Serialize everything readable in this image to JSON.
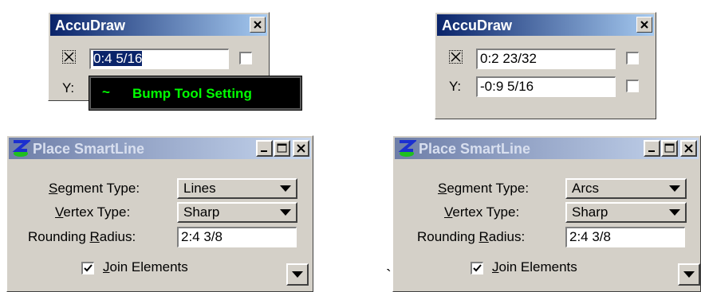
{
  "left": {
    "accudraw": {
      "title": "AccuDraw",
      "x_label": "X:",
      "x_value": "0:4  5/16",
      "y_label": "Y:",
      "tooltip_symbol": "~",
      "tooltip_text": "Bump Tool Setting"
    },
    "smartline": {
      "title": "Place SmartLine",
      "segment_label_u": "S",
      "segment_label_rest": "egment Type:",
      "segment_value": "Lines",
      "vertex_label_u": "V",
      "vertex_label_rest": "ertex Type:",
      "vertex_value": "Sharp",
      "rounding_label_a": "Rounding ",
      "rounding_label_u": "R",
      "rounding_label_b": "adius:",
      "rounding_value": "2:4  3/8",
      "join_label_u": "J",
      "join_label_rest": "oin Elements"
    }
  },
  "right": {
    "accudraw": {
      "title": "AccuDraw",
      "x_label": "X:",
      "x_value": "0:2  23/32",
      "y_label": "Y:",
      "y_value": "-0:9  5/16"
    },
    "smartline": {
      "title": "Place SmartLine",
      "segment_label_u": "S",
      "segment_label_rest": "egment Type:",
      "segment_value": "Arcs",
      "vertex_label_u": "V",
      "vertex_label_rest": "ertex Type:",
      "vertex_value": "Sharp",
      "rounding_label_a": "Rounding ",
      "rounding_label_u": "R",
      "rounding_label_b": "adius:",
      "rounding_value": "2:4  3/8",
      "join_label_u": "J",
      "join_label_rest": "oin Elements"
    }
  },
  "stray_mark": "`",
  "colors": {
    "dialog_bg": "#d4d0c8",
    "active_title_start": "#0a246a",
    "active_title_end": "#a6caf0",
    "tooltip_bg": "#000000",
    "tooltip_text": "#00ff00"
  },
  "icons": [
    "close-icon",
    "minimize-icon",
    "maximize-icon",
    "lock-x-icon",
    "checkmark-icon",
    "dropdown-arrow-icon",
    "bentley-logo-icon"
  ]
}
